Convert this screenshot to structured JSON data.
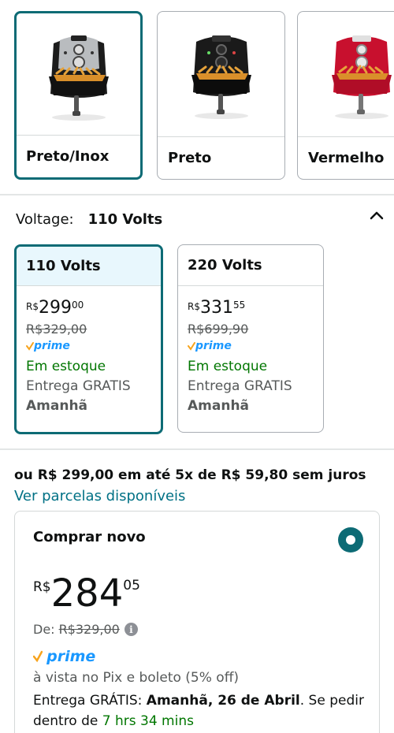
{
  "colors": {
    "accent": "#0d6b75",
    "link": "#007185",
    "green": "#007600",
    "gray": "#565959",
    "prime_blue": "#1a98ff",
    "prime_orange": "#f7a31c",
    "selected_header_bg": "#e8f7fd"
  },
  "swatches": [
    {
      "label": "Preto/Inox",
      "selected": true,
      "icon": "airfryer-black-inox-icon"
    },
    {
      "label": "Preto",
      "selected": false,
      "icon": "airfryer-black-icon"
    },
    {
      "label": "Vermelho",
      "selected": false,
      "icon": "airfryer-red-icon"
    }
  ],
  "voltage": {
    "label": "Voltage:",
    "value": "110 Volts",
    "options": [
      {
        "name": "110 Volts",
        "currency": "R$",
        "whole": "299",
        "fraction": "00",
        "list_price": "R$329,00",
        "prime": "prime",
        "stock": "Em estoque",
        "delivery": "Entrega GRATIS",
        "day": "Amanhã",
        "selected": true
      },
      {
        "name": "220 Volts",
        "currency": "R$",
        "whole": "331",
        "fraction": "55",
        "list_price": "R$699,90",
        "prime": "prime",
        "stock": "Em estoque",
        "delivery": "Entrega GRATIS",
        "day": "Amanhã",
        "selected": false
      }
    ]
  },
  "installment": {
    "text": "ou R$ 299,00 em até 5x de R$ 59,80 sem juros",
    "link": "Ver parcelas disponíveis"
  },
  "buybox": {
    "title": "Comprar novo",
    "currency": "R$",
    "whole": "284",
    "fraction": "05",
    "list_label": "De:",
    "list_price": "R$329,00",
    "prime": "prime",
    "pix_text": "à vista no Pix e boleto (5% off)",
    "delivery_prefix": "Entrega GRÁTIS: ",
    "delivery_date": "Amanhã, 26 de Abril",
    "delivery_mid": ". Se pedir dentro de ",
    "delivery_time": "7 hrs 34 mins"
  }
}
